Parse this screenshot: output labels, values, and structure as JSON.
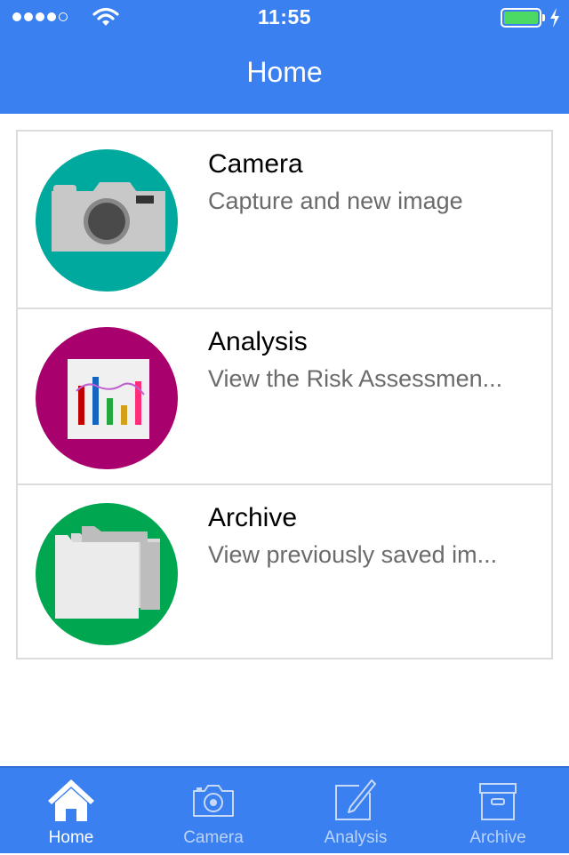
{
  "status_bar": {
    "time": "11:55",
    "battery_color": "#4cd964",
    "signal_icon": "signal-dots-icon",
    "wifi_icon": "wifi-icon",
    "battery_icon": "battery-icon",
    "charging_icon": "bolt-icon"
  },
  "header": {
    "title": "Home",
    "color": "#3a80f0"
  },
  "menu": {
    "items": [
      {
        "title": "Camera",
        "subtitle": "Capture and new image",
        "icon": "camera-icon",
        "circle_color": "#00a99d"
      },
      {
        "title": "Analysis",
        "subtitle": "View the Risk Assessmen...",
        "icon": "bar-chart-icon",
        "circle_color": "#a8006d"
      },
      {
        "title": "Archive",
        "subtitle": "View previously saved im...",
        "icon": "folders-icon",
        "circle_color": "#00a650"
      }
    ]
  },
  "tabbar": {
    "color": "#3a80f0",
    "active": "Home",
    "tabs": [
      {
        "label": "Home",
        "icon": "home-icon"
      },
      {
        "label": "Camera",
        "icon": "camera-outline-icon"
      },
      {
        "label": "Analysis",
        "icon": "pencil-edit-icon"
      },
      {
        "label": "Archive",
        "icon": "archive-box-icon"
      }
    ]
  }
}
